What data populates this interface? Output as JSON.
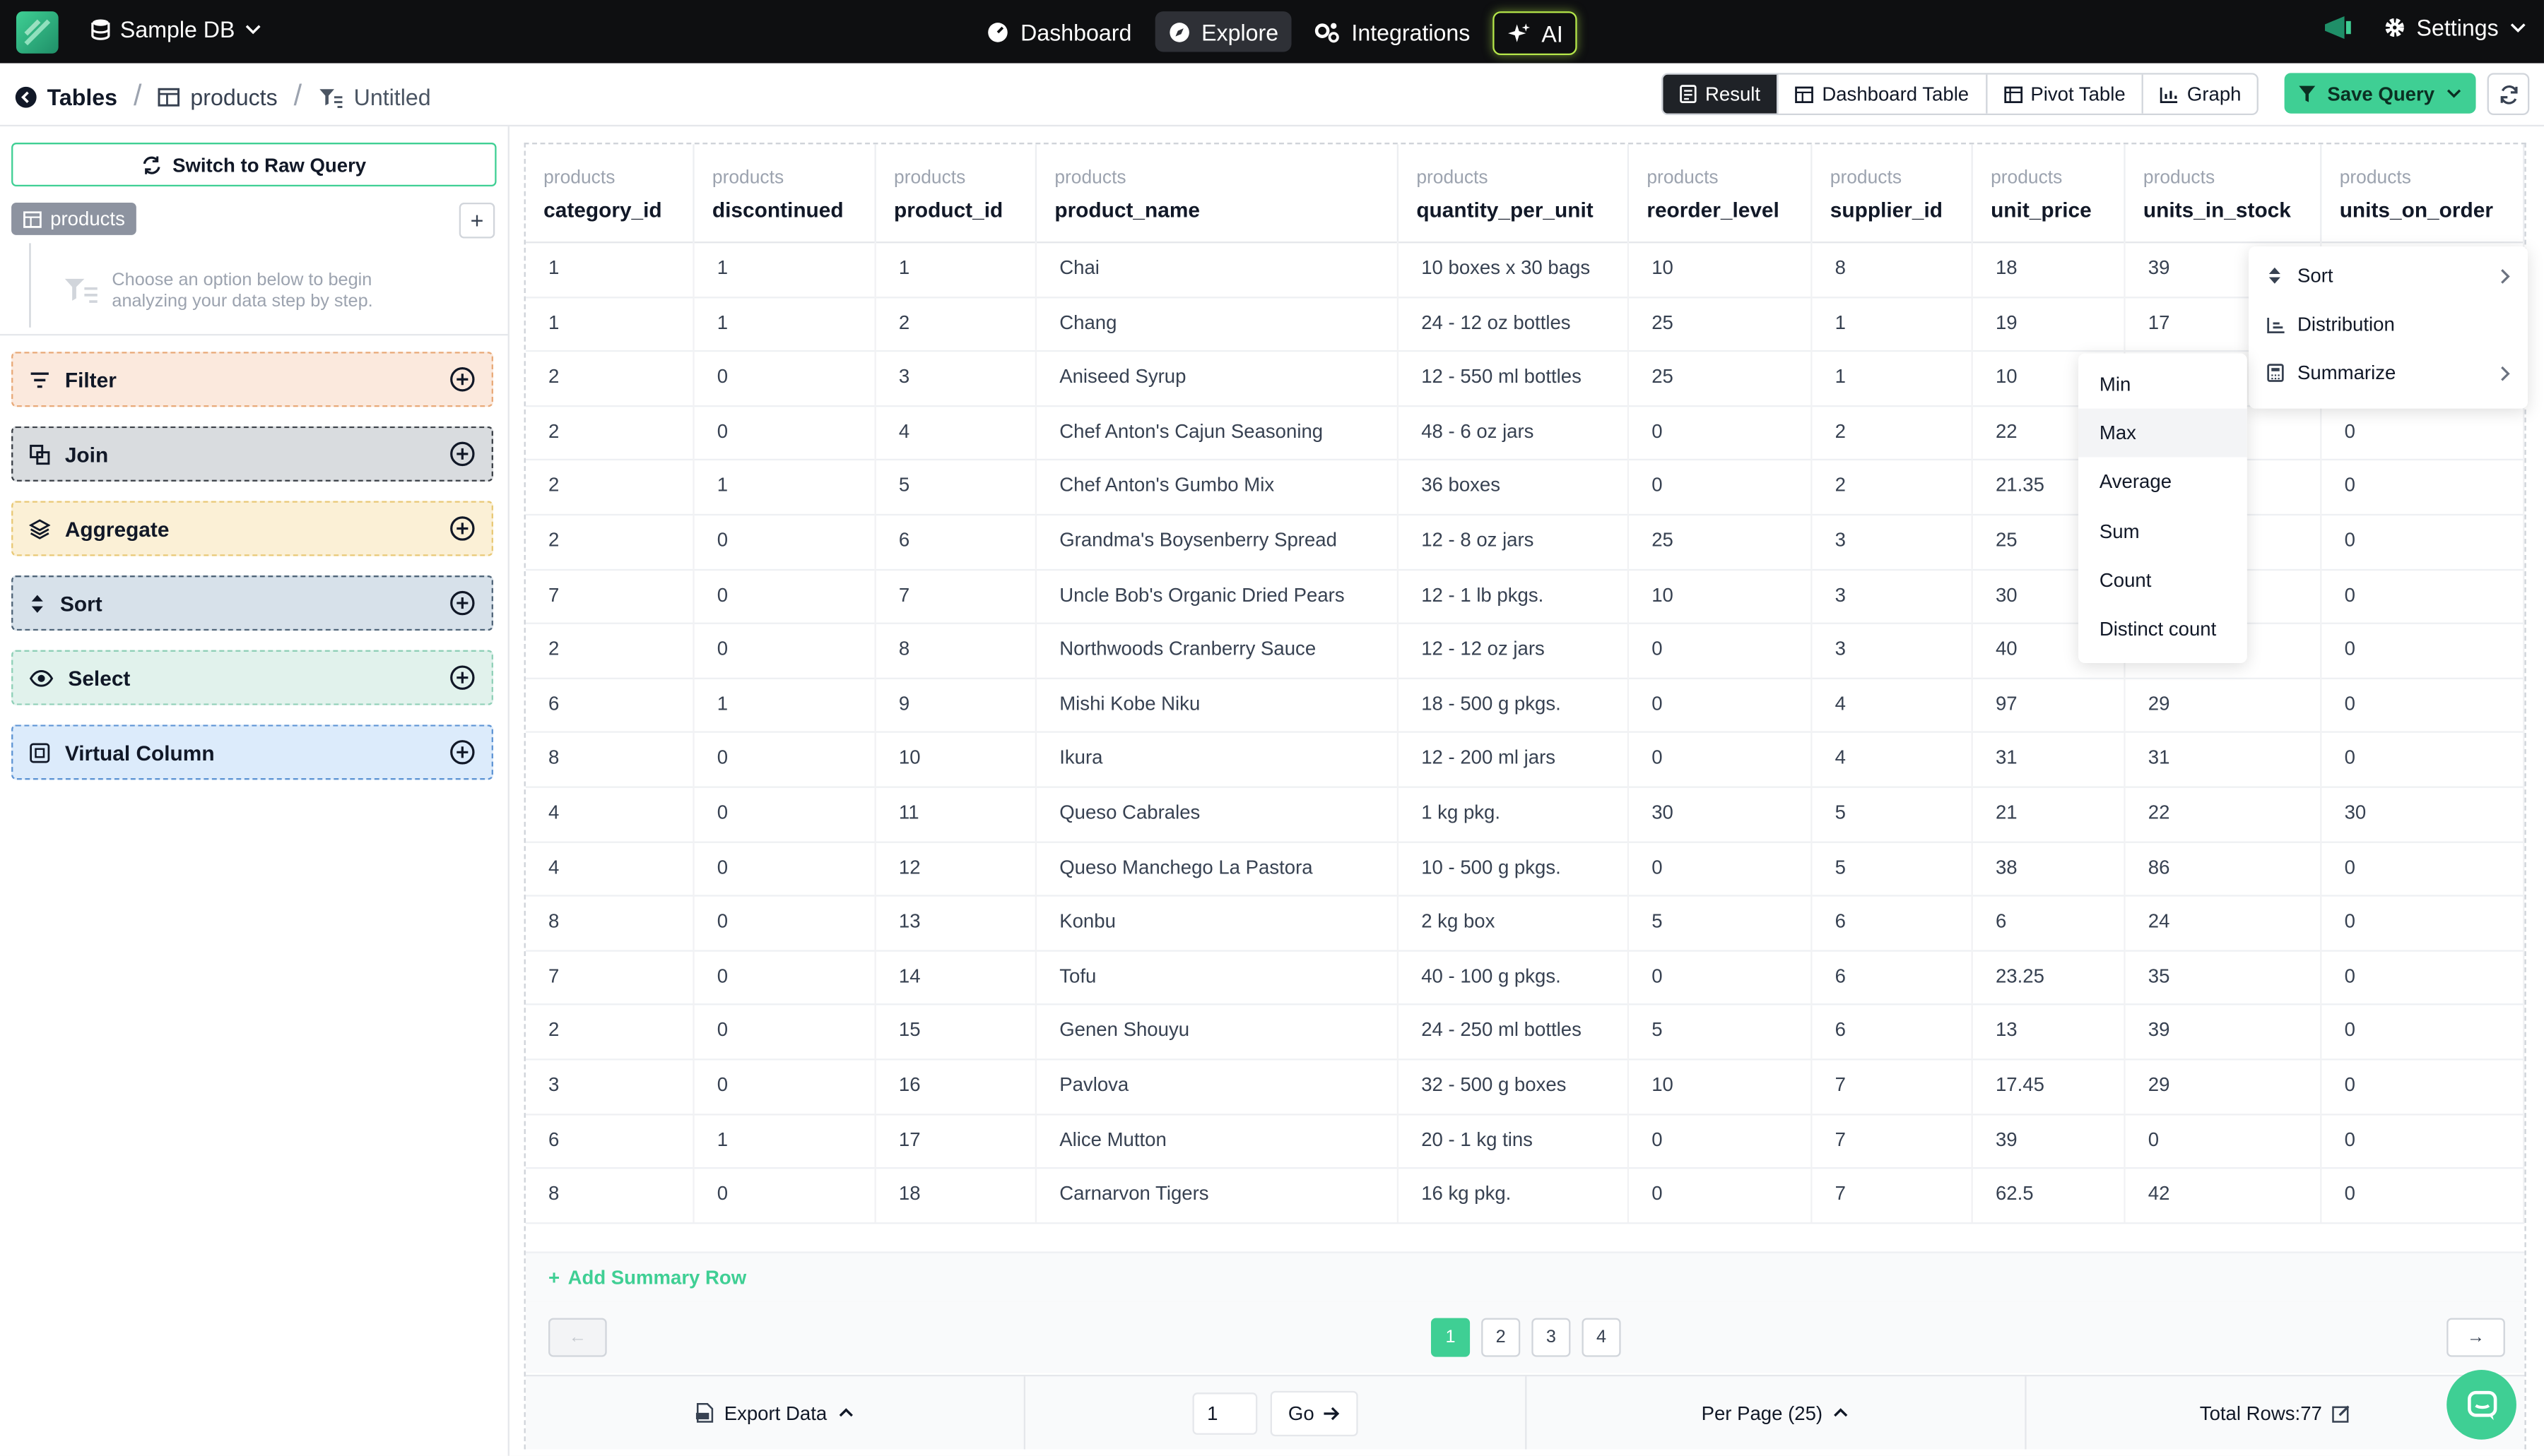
{
  "topbar": {
    "db_name": "Sample DB",
    "nav": [
      "Dashboard",
      "Explore",
      "Integrations",
      "AI"
    ],
    "active_nav": "Explore",
    "settings_label": "Settings"
  },
  "breadcrumb": {
    "root": "Tables",
    "table": "products",
    "query": "Untitled"
  },
  "view_tabs": [
    "Result",
    "Dashboard Table",
    "Pivot Table",
    "Graph"
  ],
  "active_view": "Result",
  "save_query_label": "Save Query",
  "sidebar": {
    "raw_query_label": "Switch to Raw Query",
    "table_chip": "products",
    "add_table_symbol": "+",
    "hint": "Choose an option below to begin analyzing your data step by step.",
    "steps": [
      {
        "label": "Filter",
        "bg": "#fbe9dd",
        "border": "#e8a978"
      },
      {
        "label": "Join",
        "bg": "#d9dcdf",
        "border": "#3a3f46"
      },
      {
        "label": "Aggregate",
        "bg": "#fbf0d6",
        "border": "#e8c875"
      },
      {
        "label": "Sort",
        "bg": "#d7e1ea",
        "border": "#4f6478"
      },
      {
        "label": "Select",
        "bg": "#e1f2ec",
        "border": "#8fd0b7"
      },
      {
        "label": "Virtual Column",
        "bg": "#dcebfb",
        "border": "#5e94d4"
      }
    ]
  },
  "table": {
    "columns": [
      {
        "table": "products",
        "name": "category_id"
      },
      {
        "table": "products",
        "name": "discontinued"
      },
      {
        "table": "products",
        "name": "product_id"
      },
      {
        "table": "products",
        "name": "product_name"
      },
      {
        "table": "products",
        "name": "quantity_per_unit"
      },
      {
        "table": "products",
        "name": "reorder_level"
      },
      {
        "table": "products",
        "name": "supplier_id"
      },
      {
        "table": "products",
        "name": "unit_price"
      },
      {
        "table": "products",
        "name": "units_in_stock"
      },
      {
        "table": "products",
        "name": "units_on_order"
      }
    ],
    "rows": [
      [
        "1",
        "1",
        "1",
        "Chai",
        "10 boxes x 30 bags",
        "10",
        "8",
        "18",
        "39",
        ""
      ],
      [
        "1",
        "1",
        "2",
        "Chang",
        "24 - 12 oz bottles",
        "25",
        "1",
        "19",
        "17",
        ""
      ],
      [
        "2",
        "0",
        "3",
        "Aniseed Syrup",
        "12 - 550 ml bottles",
        "25",
        "1",
        "10",
        "",
        ""
      ],
      [
        "2",
        "0",
        "4",
        "Chef Anton's Cajun Seasoning",
        "48 - 6 oz jars",
        "0",
        "2",
        "22",
        "",
        "0"
      ],
      [
        "2",
        "1",
        "5",
        "Chef Anton's Gumbo Mix",
        "36 boxes",
        "0",
        "2",
        "21.35",
        "",
        "0"
      ],
      [
        "2",
        "0",
        "6",
        "Grandma's Boysenberry Spread",
        "12 - 8 oz jars",
        "25",
        "3",
        "25",
        "",
        "0"
      ],
      [
        "7",
        "0",
        "7",
        "Uncle Bob's Organic Dried Pears",
        "12 - 1 lb pkgs.",
        "10",
        "3",
        "30",
        "",
        "0"
      ],
      [
        "2",
        "0",
        "8",
        "Northwoods Cranberry Sauce",
        "12 - 12 oz jars",
        "0",
        "3",
        "40",
        "",
        "0"
      ],
      [
        "6",
        "1",
        "9",
        "Mishi Kobe Niku",
        "18 - 500 g pkgs.",
        "0",
        "4",
        "97",
        "29",
        "0"
      ],
      [
        "8",
        "0",
        "10",
        "Ikura",
        "12 - 200 ml jars",
        "0",
        "4",
        "31",
        "31",
        "0"
      ],
      [
        "4",
        "0",
        "11",
        "Queso Cabrales",
        "1 kg pkg.",
        "30",
        "5",
        "21",
        "22",
        "30"
      ],
      [
        "4",
        "0",
        "12",
        "Queso Manchego La Pastora",
        "10 - 500 g pkgs.",
        "0",
        "5",
        "38",
        "86",
        "0"
      ],
      [
        "8",
        "0",
        "13",
        "Konbu",
        "2 kg box",
        "5",
        "6",
        "6",
        "24",
        "0"
      ],
      [
        "7",
        "0",
        "14",
        "Tofu",
        "40 - 100 g pkgs.",
        "0",
        "6",
        "23.25",
        "35",
        "0"
      ],
      [
        "2",
        "0",
        "15",
        "Genen Shouyu",
        "24 - 250 ml bottles",
        "5",
        "6",
        "13",
        "39",
        "0"
      ],
      [
        "3",
        "0",
        "16",
        "Pavlova",
        "32 - 500 g boxes",
        "10",
        "7",
        "17.45",
        "29",
        "0"
      ],
      [
        "6",
        "1",
        "17",
        "Alice Mutton",
        "20 - 1 kg tins",
        "0",
        "7",
        "39",
        "0",
        "0"
      ],
      [
        "8",
        "0",
        "18",
        "Carnarvon Tigers",
        "16 kg pkg.",
        "0",
        "7",
        "62.5",
        "42",
        "0"
      ]
    ]
  },
  "add_summary_label": "Add Summary Row",
  "pagination": {
    "pages": [
      "1",
      "2",
      "3",
      "4"
    ],
    "current": "1",
    "prev_symbol": "←",
    "next_symbol": "→"
  },
  "footer": {
    "export_label": "Export Data",
    "page_input_value": "1",
    "go_label": "Go",
    "per_page_label": "Per Page (25)",
    "total_rows_label": "Total Rows:77"
  },
  "column_menu": {
    "items": [
      "Sort",
      "Distribution",
      "Summarize"
    ]
  },
  "summarize_submenu": {
    "items": [
      "Min",
      "Max",
      "Average",
      "Sum",
      "Count",
      "Distinct count"
    ],
    "hovered": "Max"
  },
  "colors": {
    "accent": "#3fcf94",
    "topbar_bg": "#0e0f11",
    "ai_border": "#b6e84a"
  }
}
